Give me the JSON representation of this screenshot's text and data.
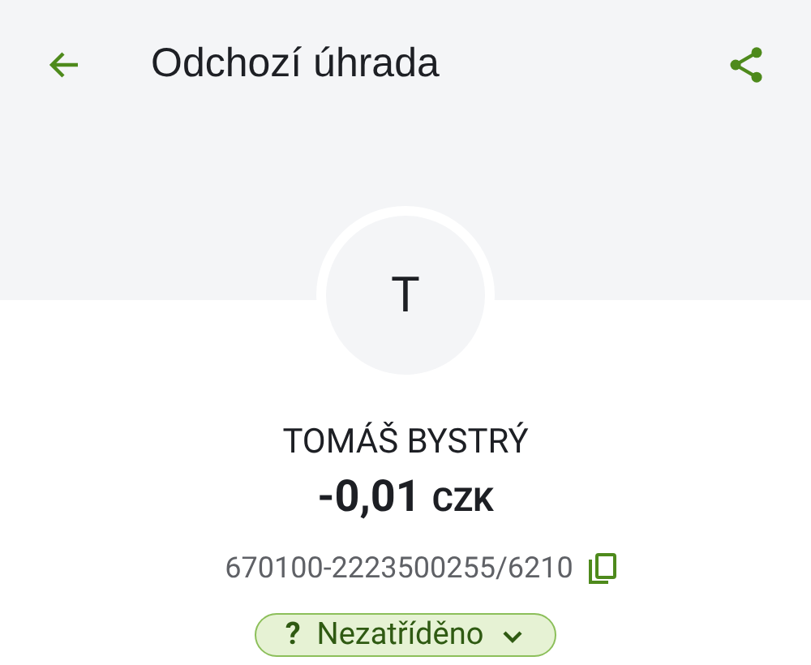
{
  "app_bar": {
    "title": "Odchozí úhrada"
  },
  "counterparty": {
    "initial": "T",
    "name": "TOMÁŠ BYSTRÝ",
    "amount": "-0,01",
    "currency": "CZK",
    "account": "670100-2223500255/6210"
  },
  "category": {
    "mark": "?",
    "label": "Nezatříděno"
  }
}
